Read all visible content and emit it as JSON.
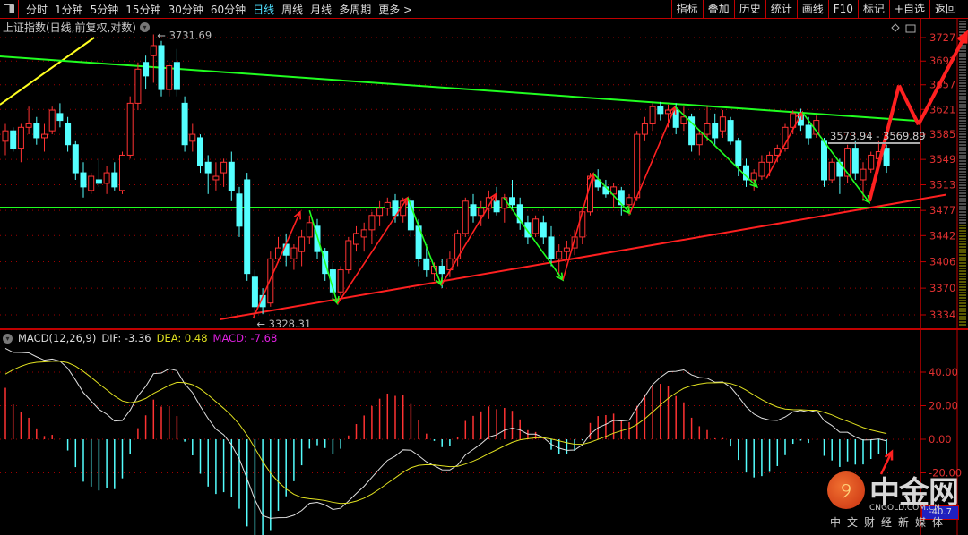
{
  "toolbar": {
    "periods": [
      "分时",
      "1分钟",
      "5分钟",
      "15分钟",
      "30分钟",
      "60分钟",
      "日线",
      "周线",
      "月线",
      "多周期",
      "更多 >"
    ],
    "active_period": "日线",
    "actions": [
      "指标",
      "叠加",
      "历史",
      "统计",
      "画线",
      "F10",
      "标记",
      "+自选",
      "返回"
    ]
  },
  "chart_title": "上证指数(日线,前复权,对数)",
  "colors": {
    "up": "#ff3232",
    "down": "#54ffff",
    "grid": "#a00000",
    "dif": "#e0e0e0",
    "dea": "#e0e020",
    "macd_label": "#e020e0",
    "trend_green": "#20ff20",
    "trend_red": "#ff2020",
    "trend_yellow": "#ffff20"
  },
  "chart_data": [
    {
      "type": "candlestick",
      "scale": "log",
      "y_ticks": [
        3727,
        3692,
        3657,
        3621,
        3585,
        3549,
        3513,
        3477,
        3442,
        3406,
        3370,
        3334
      ],
      "ohlc": [
        [
          3575,
          3600,
          3555,
          3590
        ],
        [
          3590,
          3595,
          3560,
          3565
        ],
        [
          3565,
          3600,
          3545,
          3595
        ],
        [
          3595,
          3625,
          3585,
          3600
        ],
        [
          3600,
          3610,
          3570,
          3580
        ],
        [
          3580,
          3600,
          3560,
          3585
        ],
        [
          3590,
          3625,
          3585,
          3620
        ],
        [
          3615,
          3630,
          3595,
          3605
        ],
        [
          3600,
          3610,
          3560,
          3570
        ],
        [
          3570,
          3575,
          3520,
          3530
        ],
        [
          3530,
          3545,
          3495,
          3510
        ],
        [
          3505,
          3530,
          3500,
          3525
        ],
        [
          3520,
          3550,
          3510,
          3515
        ],
        [
          3515,
          3540,
          3500,
          3530
        ],
        [
          3530,
          3545,
          3505,
          3510
        ],
        [
          3505,
          3560,
          3500,
          3555
        ],
        [
          3555,
          3640,
          3550,
          3630
        ],
        [
          3630,
          3690,
          3620,
          3680
        ],
        [
          3690,
          3700,
          3650,
          3670
        ],
        [
          3700,
          3731.69,
          3660,
          3715
        ],
        [
          3715,
          3722,
          3640,
          3650
        ],
        [
          3650,
          3690,
          3640,
          3685
        ],
        [
          3690,
          3710,
          3640,
          3650
        ],
        [
          3630,
          3640,
          3560,
          3570
        ],
        [
          3575,
          3600,
          3560,
          3585
        ],
        [
          3580,
          3585,
          3530,
          3540
        ],
        [
          3545,
          3555,
          3500,
          3530
        ],
        [
          3520,
          3545,
          3505,
          3525
        ],
        [
          3530,
          3550,
          3510,
          3545
        ],
        [
          3545,
          3560,
          3490,
          3505
        ],
        [
          3500,
          3510,
          3440,
          3455
        ],
        [
          3520,
          3530,
          3380,
          3390
        ],
        [
          3385,
          3395,
          3328.31,
          3345
        ],
        [
          3360,
          3370,
          3335,
          3345
        ],
        [
          3350,
          3420,
          3345,
          3410
        ],
        [
          3410,
          3440,
          3405,
          3425
        ],
        [
          3430,
          3445,
          3400,
          3415
        ],
        [
          3410,
          3430,
          3395,
          3425
        ],
        [
          3420,
          3450,
          3400,
          3440
        ],
        [
          3440,
          3470,
          3430,
          3460
        ],
        [
          3455,
          3465,
          3410,
          3420
        ],
        [
          3420,
          3425,
          3380,
          3390
        ],
        [
          3395,
          3405,
          3355,
          3365
        ],
        [
          3365,
          3400,
          3360,
          3395
        ],
        [
          3395,
          3440,
          3390,
          3435
        ],
        [
          3430,
          3455,
          3420,
          3445
        ],
        [
          3440,
          3460,
          3420,
          3450
        ],
        [
          3450,
          3475,
          3430,
          3470
        ],
        [
          3470,
          3490,
          3455,
          3480
        ],
        [
          3480,
          3495,
          3470,
          3488
        ],
        [
          3490,
          3500,
          3460,
          3470
        ],
        [
          3470,
          3495,
          3460,
          3490
        ],
        [
          3490,
          3495,
          3440,
          3450
        ],
        [
          3455,
          3465,
          3400,
          3410
        ],
        [
          3410,
          3430,
          3385,
          3395
        ],
        [
          3390,
          3405,
          3380,
          3400
        ],
        [
          3400,
          3410,
          3370,
          3390
        ],
        [
          3395,
          3420,
          3385,
          3410
        ],
        [
          3410,
          3450,
          3400,
          3445
        ],
        [
          3445,
          3495,
          3440,
          3490
        ],
        [
          3485,
          3500,
          3460,
          3470
        ],
        [
          3470,
          3490,
          3455,
          3480
        ],
        [
          3480,
          3505,
          3465,
          3495
        ],
        [
          3490,
          3510,
          3470,
          3475
        ],
        [
          3480,
          3500,
          3460,
          3495
        ],
        [
          3495,
          3520,
          3480,
          3485
        ],
        [
          3485,
          3495,
          3450,
          3460
        ],
        [
          3460,
          3470,
          3430,
          3440
        ],
        [
          3445,
          3470,
          3440,
          3465
        ],
        [
          3460,
          3470,
          3430,
          3440
        ],
        [
          3440,
          3455,
          3400,
          3410
        ],
        [
          3410,
          3430,
          3385,
          3420
        ],
        [
          3420,
          3435,
          3410,
          3425
        ],
        [
          3425,
          3450,
          3415,
          3440
        ],
        [
          3440,
          3480,
          3430,
          3475
        ],
        [
          3475,
          3530,
          3470,
          3525
        ],
        [
          3520,
          3535,
          3505,
          3510
        ],
        [
          3510,
          3520,
          3495,
          3500
        ],
        [
          3500,
          3515,
          3480,
          3510
        ],
        [
          3505,
          3510,
          3470,
          3485
        ],
        [
          3485,
          3500,
          3470,
          3495
        ],
        [
          3495,
          3590,
          3490,
          3585
        ],
        [
          3585,
          3610,
          3575,
          3600
        ],
        [
          3600,
          3630,
          3590,
          3625
        ],
        [
          3625,
          3632,
          3605,
          3615
        ],
        [
          3615,
          3628,
          3595,
          3620
        ],
        [
          3620,
          3630,
          3585,
          3595
        ],
        [
          3600,
          3625,
          3590,
          3610
        ],
        [
          3610,
          3615,
          3560,
          3570
        ],
        [
          3570,
          3590,
          3555,
          3585
        ],
        [
          3585,
          3625,
          3575,
          3600
        ],
        [
          3600,
          3615,
          3570,
          3580
        ],
        [
          3590,
          3620,
          3580,
          3610
        ],
        [
          3605,
          3610,
          3570,
          3575
        ],
        [
          3575,
          3580,
          3525,
          3540
        ],
        [
          3540,
          3550,
          3510,
          3520
        ],
        [
          3520,
          3535,
          3505,
          3530
        ],
        [
          3525,
          3555,
          3520,
          3545
        ],
        [
          3545,
          3560,
          3525,
          3555
        ],
        [
          3555,
          3570,
          3545,
          3565
        ],
        [
          3565,
          3600,
          3560,
          3595
        ],
        [
          3595,
          3620,
          3585,
          3615
        ],
        [
          3615,
          3622,
          3590,
          3598
        ],
        [
          3598,
          3610,
          3570,
          3580
        ],
        [
          3585,
          3612,
          3580,
          3605
        ],
        [
          3575,
          3580,
          3510,
          3520
        ],
        [
          3520,
          3550,
          3515,
          3545
        ],
        [
          3545,
          3550,
          3500,
          3525
        ],
        [
          3525,
          3570,
          3515,
          3565
        ],
        [
          3565,
          3575,
          3520,
          3530
        ],
        [
          3520,
          3545,
          3490,
          3535
        ],
        [
          3535,
          3560,
          3530,
          3555
        ],
        [
          3550,
          3575,
          3535,
          3560
        ],
        [
          3565,
          3570,
          3530,
          3540
        ]
      ],
      "high_label": "3731.69",
      "low_label": "3328.31",
      "range_label": "3573.94 - 3569.89",
      "trendlines": [
        {
          "color": "trend_yellow",
          "from": [
            -0.7,
            3628
          ],
          "to": [
            11.4,
            3727
          ]
        },
        {
          "color": "trend_green",
          "from": [
            -0.7,
            3699
          ],
          "to": [
            117.4,
            3604
          ]
        },
        {
          "color": "trend_green",
          "from": [
            -0.7,
            3481
          ],
          "to": [
            117.4,
            3481
          ]
        },
        {
          "color": "trend_red",
          "from": [
            27.5,
            3328
          ],
          "to": [
            120.6,
            3499
          ]
        }
      ],
      "arrows": [
        {
          "color": "trend_red",
          "from": [
            31.8,
            3330
          ],
          "to": [
            37.8,
            3475
          ]
        },
        {
          "color": "trend_green",
          "from": [
            39,
            3477
          ],
          "to": [
            42.6,
            3349
          ]
        },
        {
          "color": "trend_red",
          "from": [
            42.6,
            3349
          ],
          "to": [
            51.6,
            3495
          ]
        },
        {
          "color": "trend_green",
          "from": [
            51.6,
            3495
          ],
          "to": [
            55.9,
            3374
          ]
        },
        {
          "color": "trend_red",
          "from": [
            55.9,
            3374
          ],
          "to": [
            62.9,
            3500
          ]
        },
        {
          "color": "trend_green",
          "from": [
            63.9,
            3495
          ],
          "to": [
            71.5,
            3381
          ]
        },
        {
          "color": "trend_red",
          "from": [
            71.5,
            3381
          ],
          "to": [
            75.4,
            3529
          ]
        },
        {
          "color": "trend_green",
          "from": [
            75.4,
            3529
          ],
          "to": [
            80.1,
            3473
          ]
        },
        {
          "color": "trend_red",
          "from": [
            80.1,
            3473
          ],
          "to": [
            85.9,
            3625
          ]
        },
        {
          "color": "trend_green",
          "from": [
            85.9,
            3625
          ],
          "to": [
            96.4,
            3510
          ]
        },
        {
          "color": "trend_red",
          "from": [
            97.6,
            3522
          ],
          "to": [
            102.2,
            3617
          ]
        },
        {
          "color": "trend_green",
          "from": [
            102.2,
            3617
          ],
          "to": [
            110.8,
            3488
          ]
        }
      ],
      "forecast_path": [
        [
          110.8,
          3490
        ],
        [
          114.6,
          3656
        ],
        [
          117.1,
          3599
        ],
        [
          123.2,
          3733
        ]
      ]
    },
    {
      "type": "macd",
      "params": "MACD(12,26,9)",
      "dif_label": "DIF: -3.36",
      "dea_label": "DEA: 0.48",
      "macd_label": "MACD: -7.68",
      "y_ticks": [
        "40.00",
        "20.00",
        "0.00",
        "-20.00"
      ],
      "y_tick_values": [
        40,
        20,
        0,
        -20
      ],
      "corner_value": "-40.7"
    }
  ],
  "logo": {
    "text": "中金网",
    "url_text": "CNGOLD.COM.CN",
    "tagline": "中文财经新媒体"
  }
}
